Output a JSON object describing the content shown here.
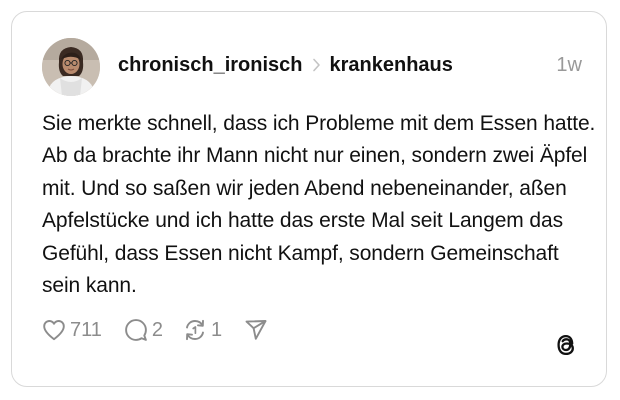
{
  "post": {
    "username": "chronisch_ironisch",
    "community": "krankenhaus",
    "timestamp": "1w",
    "text": "Sie merkte schnell, dass ich Probleme mit dem Essen hatte. Ab da brachte ihr Mann nicht nur einen, sondern zwei Äpfel mit. Und so saßen wir jeden Abend nebeneinander, aßen Apfelstücke und ich hatte das erste Mal seit Langem das Gefühl, dass Essen nicht Kampf, sondern Gemeinschaft sein kann."
  },
  "actions": {
    "likes": "711",
    "replies": "2",
    "reposts": "1"
  },
  "icons": {
    "like": "heart-icon",
    "reply": "speech-bubble-icon",
    "repost": "repost-arrows-icon",
    "share": "paper-plane-icon",
    "brand": "threads-logo-icon",
    "separator": "chevron-right-icon"
  },
  "colors": {
    "text": "#111111",
    "muted": "#8c8c8c",
    "border": "#d9d9d9",
    "background": "#ffffff"
  }
}
